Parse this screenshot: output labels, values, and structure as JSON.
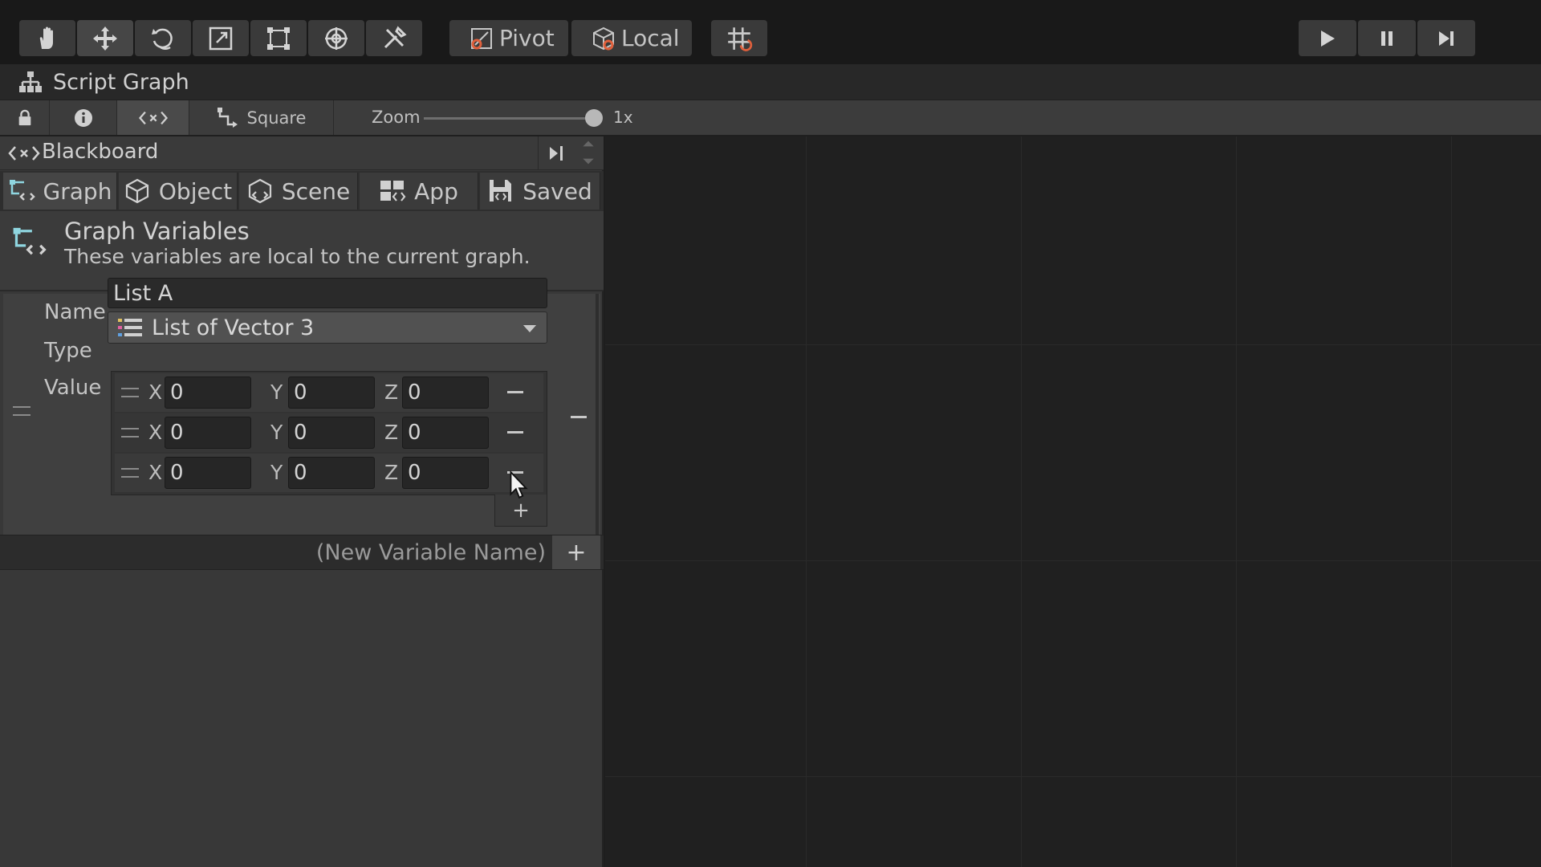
{
  "toolbar": {
    "tools": [
      "hand-tool",
      "move-tool",
      "rotate-tool",
      "scale-tool",
      "rect-tool",
      "transform-tool",
      "custom-tool"
    ],
    "pivot_label": "Pivot",
    "local_label": "Local",
    "grid_snap": "grid-snap-icon",
    "playback": [
      "play-icon",
      "pause-icon",
      "step-icon"
    ]
  },
  "window": {
    "title": "Script Graph"
  },
  "graph_toolbar": {
    "square_label": "Square",
    "zoom_label": "Zoom",
    "zoom_level": 1,
    "zoom_value": "1x"
  },
  "blackboard": {
    "title": "Blackboard",
    "tabs": [
      {
        "label": "Graph"
      },
      {
        "label": "Object"
      },
      {
        "label": "Scene"
      },
      {
        "label": "App"
      },
      {
        "label": "Saved"
      }
    ],
    "section_title": "Graph Variables",
    "section_desc": "These variables are local to the current graph.",
    "variable": {
      "name_label": "Name",
      "name_value": "List A",
      "type_label": "Type",
      "type_value": "List of Vector 3",
      "value_label": "Value",
      "items": [
        {
          "x": "0",
          "y": "0",
          "z": "0"
        },
        {
          "x": "0",
          "y": "0",
          "z": "0"
        },
        {
          "x": "0",
          "y": "0",
          "z": "0"
        }
      ],
      "axis_x": "X",
      "axis_y": "Y",
      "axis_z": "Z"
    },
    "new_variable_placeholder": "(New Variable Name)",
    "add_symbol": "+"
  },
  "colors": {
    "accent_icon": "#8fd6e0",
    "pivot_icon": "#e0603c"
  }
}
